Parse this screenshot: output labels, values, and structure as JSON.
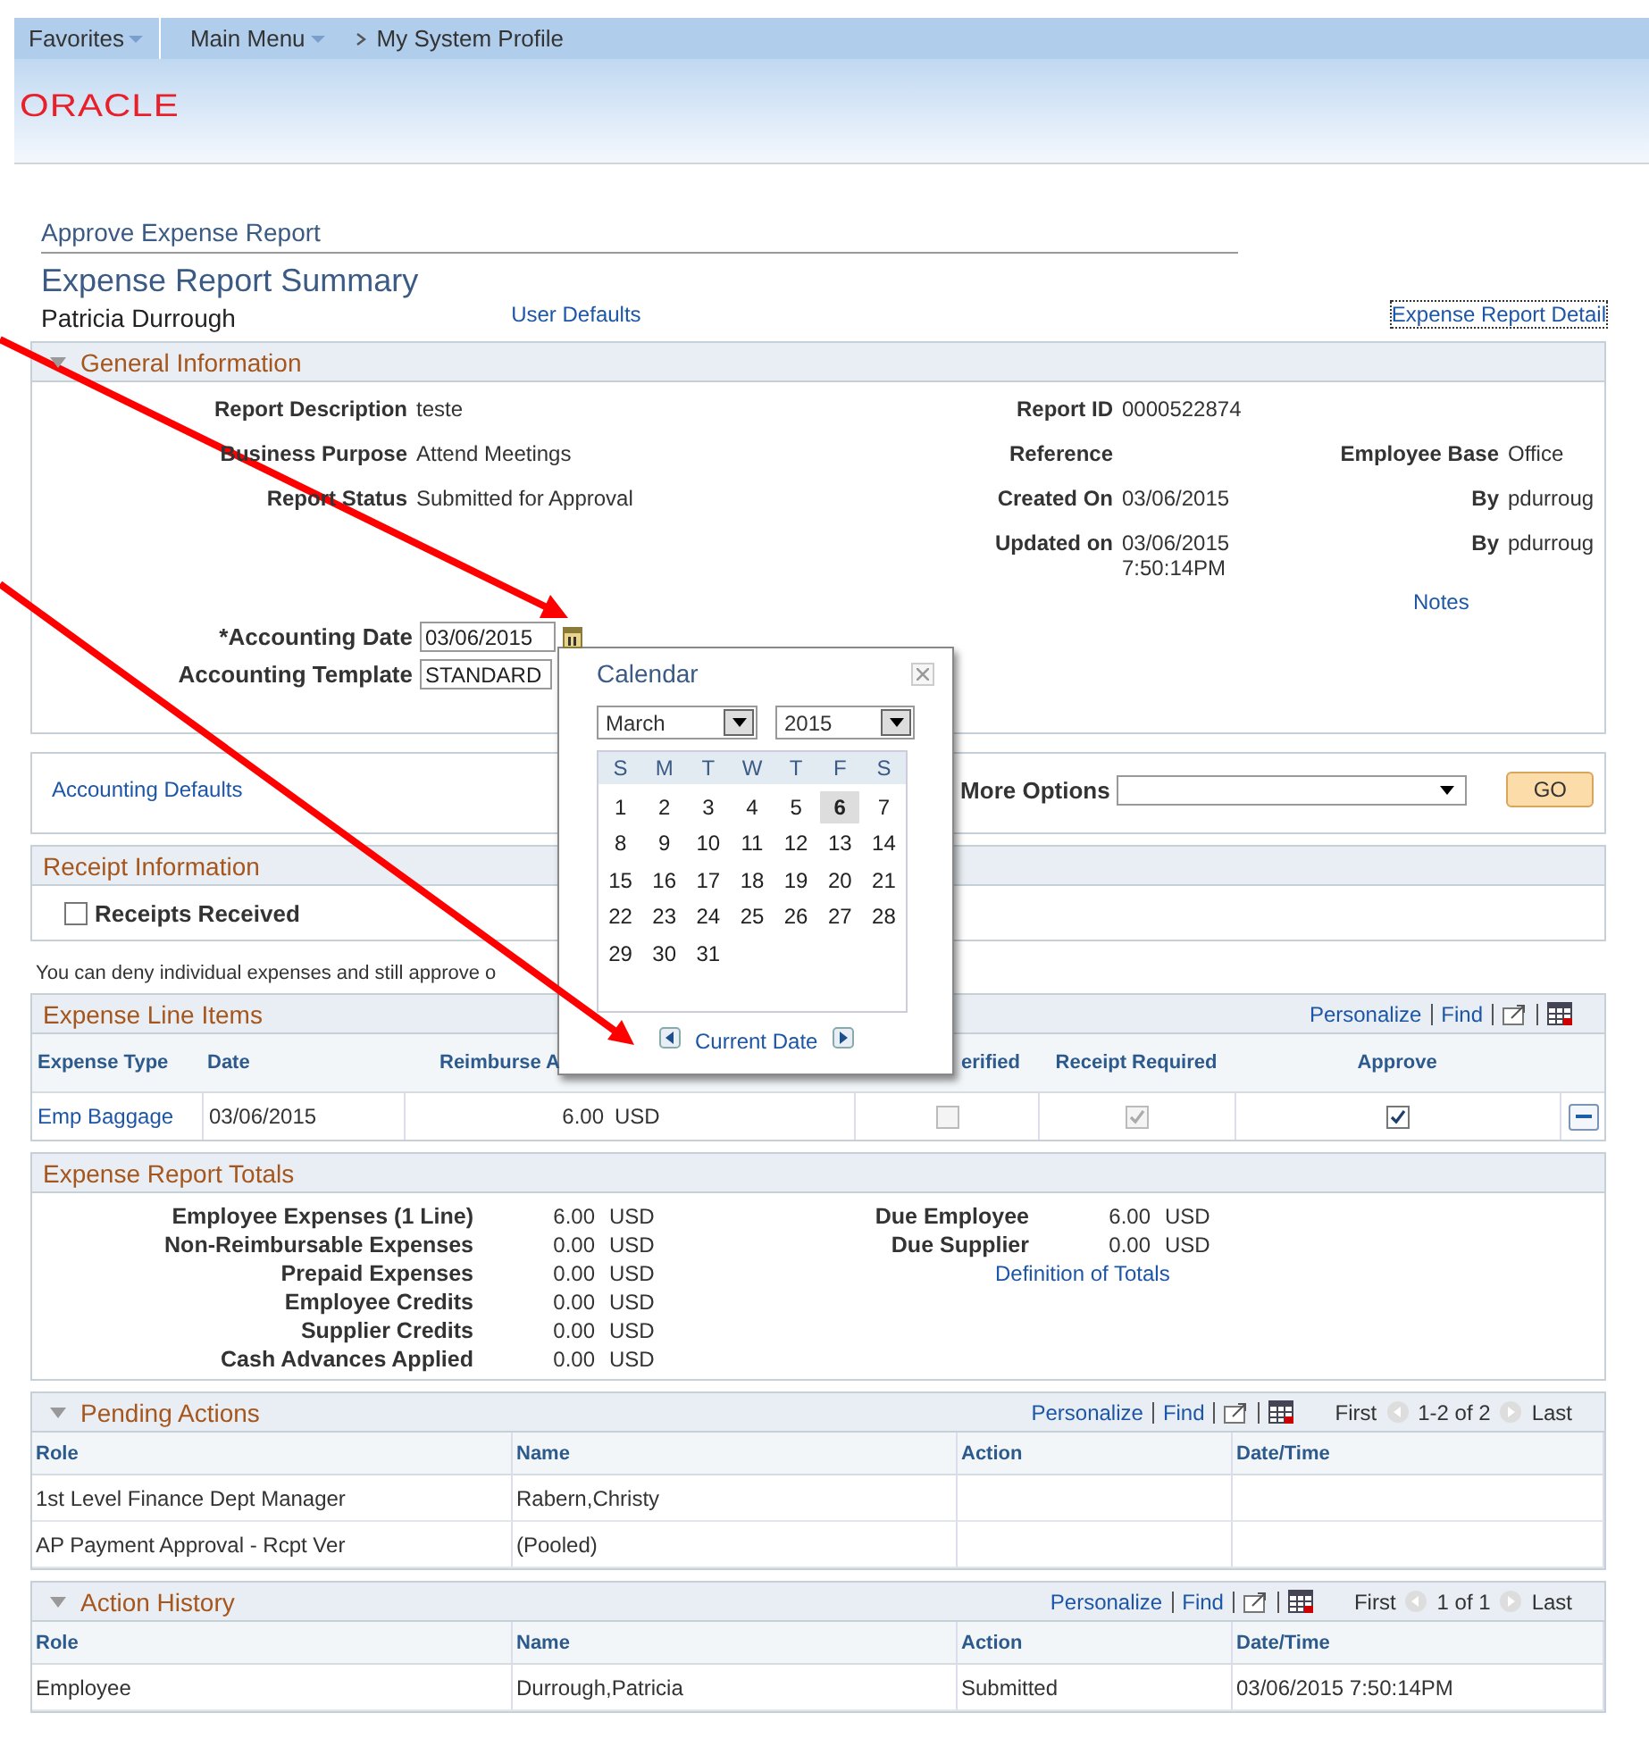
{
  "nav": {
    "favorites": "Favorites",
    "main_menu": "Main Menu",
    "breadcrumb": "My System Profile"
  },
  "logo": "ORACLE",
  "header": {
    "breadcrumb": "Approve Expense Report",
    "title": "Expense Report Summary",
    "employee": "Patricia Durrough",
    "user_defaults": "User Defaults",
    "detail_link": "Expense Report Detail"
  },
  "general": {
    "title": "General Information",
    "rows": [
      {
        "cells": [
          {
            "label": "Report Description",
            "value": "teste"
          },
          {
            "label": "Report ID",
            "value": "0000522874"
          },
          null
        ]
      },
      {
        "cells": [
          {
            "label": "Business Purpose",
            "value": "Attend Meetings"
          },
          {
            "label": "Reference"
          },
          {
            "label": "Employee Base",
            "value": "Office"
          }
        ]
      },
      {
        "cells": [
          {
            "label": "Report Status",
            "value": "Submitted for Approval"
          },
          {
            "label": "Created On",
            "value": "03/06/2015"
          },
          {
            "label": "By",
            "value": "pdurroug"
          }
        ]
      },
      {
        "cells": [
          null,
          {
            "label": "Updated on",
            "value": "03/06/2015",
            "value_line2": "7:50:14PM"
          },
          {
            "label": "By",
            "value": "pdurroug"
          }
        ]
      }
    ],
    "notes_link": "Notes",
    "accounting_date": {
      "label": "*Accounting Date",
      "value": "03/06/2015"
    },
    "accounting_template": {
      "label": "Accounting Template",
      "value": "STANDARD"
    }
  },
  "defaults": {
    "link": "Accounting Defaults",
    "more_options_label": "More Options",
    "go": "GO"
  },
  "receipts": {
    "title": "Receipt Information",
    "label": "Receipts Received",
    "checked": false
  },
  "note": "You can deny individual expenses and still approve o",
  "expense_lines": {
    "title": "Expense Line Items",
    "personalize": "Personalize",
    "find": "Find",
    "columns": [
      "Expense Type",
      "Date",
      "Reimburse A",
      "erified",
      "Receipt Required",
      "Approve"
    ],
    "rows": [
      {
        "expense_type": "Emp Baggage",
        "date": "03/06/2015",
        "amount": "6.00",
        "currency": "USD",
        "verified": {
          "checked": false,
          "disabled": true
        },
        "receipt_required": {
          "checked": true,
          "disabled": true
        },
        "approve": {
          "checked": true,
          "disabled": false
        }
      }
    ]
  },
  "totals": {
    "title": "Expense Report Totals",
    "left": [
      {
        "label": "Employee Expenses (1 Line)",
        "amount": "6.00",
        "currency": "USD"
      },
      {
        "label": "Non-Reimbursable Expenses",
        "amount": "0.00",
        "currency": "USD"
      },
      {
        "label": "Prepaid Expenses",
        "amount": "0.00",
        "currency": "USD"
      },
      {
        "label": "Employee Credits",
        "amount": "0.00",
        "currency": "USD"
      },
      {
        "label": "Supplier Credits",
        "amount": "0.00",
        "currency": "USD"
      },
      {
        "label": "Cash Advances Applied",
        "amount": "0.00",
        "currency": "USD"
      }
    ],
    "right": [
      {
        "label": "Due Employee",
        "amount": "6.00",
        "currency": "USD"
      },
      {
        "label": "Due Supplier",
        "amount": "0.00",
        "currency": "USD"
      }
    ],
    "link": "Definition of Totals"
  },
  "grids": [
    {
      "title": "Pending Actions",
      "personalize": "Personalize",
      "find": "Find",
      "first": "First",
      "range": "1-2 of 2",
      "last": "Last",
      "columns": [
        "Role",
        "Name",
        "Action",
        "Date/Time"
      ],
      "rows": [
        {
          "role": "1st Level Finance Dept Manager",
          "name": "Rabern,Christy"
        },
        {
          "role": "AP Payment Approval - Rcpt Ver",
          "name": "(Pooled)"
        }
      ]
    },
    {
      "title": "Action History",
      "personalize": "Personalize",
      "find": "Find",
      "first": "First",
      "range": "1 of 1",
      "last": "Last",
      "columns": [
        "Role",
        "Name",
        "Action",
        "Date/Time"
      ],
      "rows": [
        {
          "role": "Employee",
          "name": "Durrough,Patricia",
          "action": "Submitted",
          "datetime": "03/06/2015  7:50:14PM"
        }
      ]
    }
  ],
  "calendar": {
    "title": "Calendar",
    "month": "March",
    "year": "2015",
    "weekdays": [
      "S",
      "M",
      "T",
      "W",
      "T",
      "F",
      "S"
    ],
    "days": [
      {
        "day": "1",
        "selected": false
      },
      {
        "day": "2",
        "selected": false
      },
      {
        "day": "3",
        "selected": false
      },
      {
        "day": "4",
        "selected": false
      },
      {
        "day": "5",
        "selected": false
      },
      {
        "day": "6",
        "selected": true
      },
      {
        "day": "7",
        "selected": false
      },
      {
        "day": "8",
        "selected": false
      },
      {
        "day": "9",
        "selected": false
      },
      {
        "day": "10",
        "selected": false
      },
      {
        "day": "11",
        "selected": false
      },
      {
        "day": "12",
        "selected": false
      },
      {
        "day": "13",
        "selected": false
      },
      {
        "day": "14",
        "selected": false
      },
      {
        "day": "15",
        "selected": false
      },
      {
        "day": "16",
        "selected": false
      },
      {
        "day": "17",
        "selected": false
      },
      {
        "day": "18",
        "selected": false
      },
      {
        "day": "19",
        "selected": false
      },
      {
        "day": "20",
        "selected": false
      },
      {
        "day": "21",
        "selected": false
      },
      {
        "day": "22",
        "selected": false
      },
      {
        "day": "23",
        "selected": false
      },
      {
        "day": "24",
        "selected": false
      },
      {
        "day": "25",
        "selected": false
      },
      {
        "day": "26",
        "selected": false
      },
      {
        "day": "27",
        "selected": false
      },
      {
        "day": "28",
        "selected": false
      },
      {
        "day": "29",
        "selected": false
      },
      {
        "day": "30",
        "selected": false
      },
      {
        "day": "31",
        "selected": false
      }
    ],
    "current_date": "Current Date"
  }
}
